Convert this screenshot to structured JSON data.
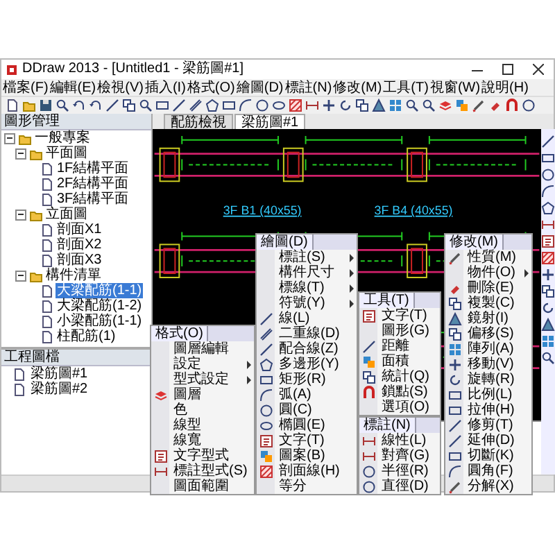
{
  "window": {
    "title": "DDraw 2013 - [Untitled1 - 梁筋圖#1]"
  },
  "menu_bar": [
    "檔案(F)",
    "編輯(E)",
    "檢視(V)",
    "插入(I)",
    "格式(O)",
    "繪圖(D)",
    "標註(N)",
    "修改(M)",
    "工具(T)",
    "視窗(W)",
    "說明(H)"
  ],
  "tree_panel": {
    "title": "圖形管理",
    "items": [
      {
        "label": "一般專案",
        "expanded": true,
        "selected": false,
        "children": [
          {
            "label": "平面圖",
            "expanded": true,
            "selected": false,
            "children": [
              {
                "label": "1F結構平面",
                "selected": false
              },
              {
                "label": "2F結構平面",
                "selected": false
              },
              {
                "label": "3F結構平面",
                "selected": false
              }
            ]
          },
          {
            "label": "立面圖",
            "expanded": true,
            "selected": false,
            "children": [
              {
                "label": "剖面X1",
                "selected": false
              },
              {
                "label": "剖面X2",
                "selected": false
              },
              {
                "label": "剖面X3",
                "selected": false
              }
            ]
          },
          {
            "label": "構件清單",
            "expanded": true,
            "selected": false,
            "children": [
              {
                "label": "大梁配筋(1-1)",
                "selected": true
              },
              {
                "label": "大梁配筋(1-2)",
                "selected": false
              },
              {
                "label": "小梁配筋(1-1)",
                "selected": false
              },
              {
                "label": "柱配筋(1)",
                "selected": false
              }
            ]
          }
        ]
      }
    ]
  },
  "files_panel": {
    "title": "工程圖檔",
    "items": [
      "梁筋圖#1",
      "梁筋圖#2"
    ]
  },
  "tabs": [
    {
      "label": "配筋檢視",
      "selected": false
    },
    {
      "label": "梁筋圖#1",
      "selected": true
    }
  ],
  "drawing": {
    "labels": [
      "3F B1 (40x55)",
      "3F B4 (40x55)"
    ]
  },
  "menus": [
    {
      "title": "格式(O)",
      "items": [
        {
          "label": "圖層編輯",
          "submenu": false
        },
        {
          "label": "設定",
          "submenu": true
        },
        {
          "label": "型式設定",
          "submenu": true
        },
        {
          "label": "圖層",
          "submenu": false
        },
        {
          "label": "色",
          "submenu": false
        },
        {
          "label": "線型",
          "submenu": false
        },
        {
          "label": "線寬",
          "submenu": false
        },
        {
          "label": "文字型式",
          "submenu": false
        },
        {
          "label": "標註型式(S)",
          "submenu": false
        },
        {
          "label": "圖面範圍",
          "submenu": false
        }
      ]
    },
    {
      "title": "繪圖(D)",
      "items": [
        {
          "label": "標註(S)",
          "submenu": true
        },
        {
          "label": "構件尺寸",
          "submenu": true
        },
        {
          "label": "標線(T)",
          "submenu": true
        },
        {
          "label": "符號(Y)",
          "submenu": true
        },
        {
          "label": "線(L)",
          "submenu": false
        },
        {
          "label": "二重線(D)",
          "submenu": false
        },
        {
          "label": "配合線(Z)",
          "submenu": false
        },
        {
          "label": "多邊形(Y)",
          "submenu": false
        },
        {
          "label": "矩形(R)",
          "submenu": false
        },
        {
          "label": "弧(A)",
          "submenu": false
        },
        {
          "label": "圓(C)",
          "submenu": false
        },
        {
          "label": "橢圓(E)",
          "submenu": false
        },
        {
          "label": "文字(T)",
          "submenu": false
        },
        {
          "label": "圖案(B)",
          "submenu": false
        },
        {
          "label": "剖面線(H)",
          "submenu": false
        },
        {
          "label": "等分",
          "submenu": false
        }
      ]
    },
    {
      "title": "標註(N)",
      "items": [
        {
          "label": "線性(L)",
          "submenu": false
        },
        {
          "label": "對齊(G)",
          "submenu": false
        },
        {
          "label": "半徑(R)",
          "submenu": false
        },
        {
          "label": "直徑(D)",
          "submenu": false
        }
      ]
    },
    {
      "title": "修改(M)",
      "items": [
        {
          "label": "性質(M)",
          "submenu": false
        },
        {
          "label": "物件(O)",
          "submenu": true
        },
        {
          "label": "刪除(E)",
          "submenu": false
        },
        {
          "label": "複製(C)",
          "submenu": false
        },
        {
          "label": "鏡射(I)",
          "submenu": false
        },
        {
          "label": "偏移(S)",
          "submenu": false
        },
        {
          "label": "陣列(A)",
          "submenu": false
        },
        {
          "label": "移動(V)",
          "submenu": false
        },
        {
          "label": "旋轉(R)",
          "submenu": false
        },
        {
          "label": "比例(L)",
          "submenu": false
        },
        {
          "label": "拉伸(H)",
          "submenu": false
        },
        {
          "label": "修剪(T)",
          "submenu": false
        },
        {
          "label": "延伸(D)",
          "submenu": false
        },
        {
          "label": "切斷(K)",
          "submenu": false
        },
        {
          "label": "圓角(F)",
          "submenu": false
        },
        {
          "label": "分解(X)",
          "submenu": false
        }
      ]
    },
    {
      "title": "工具(T)",
      "items": [
        {
          "label": "文字(T)",
          "submenu": false
        },
        {
          "label": "圖形(G)",
          "submenu": false
        },
        {
          "label": "距離",
          "submenu": false
        },
        {
          "label": "面積",
          "submenu": false
        },
        {
          "label": "統計(Q)",
          "submenu": false
        },
        {
          "label": "鎖點(S)",
          "submenu": false
        },
        {
          "label": "選項(O)",
          "submenu": false
        }
      ]
    }
  ]
}
